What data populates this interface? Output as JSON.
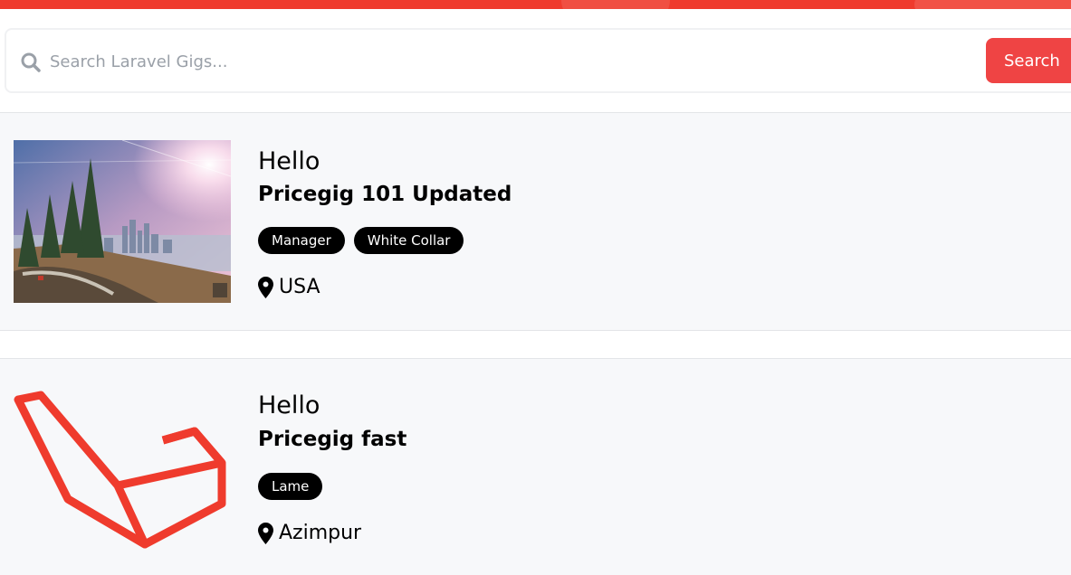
{
  "colors": {
    "accent": "#ef3b2d",
    "search_button": "#ef4444",
    "card_bg": "#f7f8fa",
    "tag_bg": "#000000"
  },
  "search": {
    "placeholder": "Search Laravel Gigs...",
    "value": "",
    "button_label": "Search",
    "icon": "search-icon"
  },
  "listings": [
    {
      "company": "Hello",
      "title": "Pricegig 101 Updated",
      "tags": [
        "Manager",
        "White Collar"
      ],
      "location": "USA",
      "image": "city-landscape-photo"
    },
    {
      "company": "Hello",
      "title": "Pricegig fast",
      "tags": [
        "Lame"
      ],
      "location": "Azimpur",
      "image": "laravel-logo"
    }
  ]
}
